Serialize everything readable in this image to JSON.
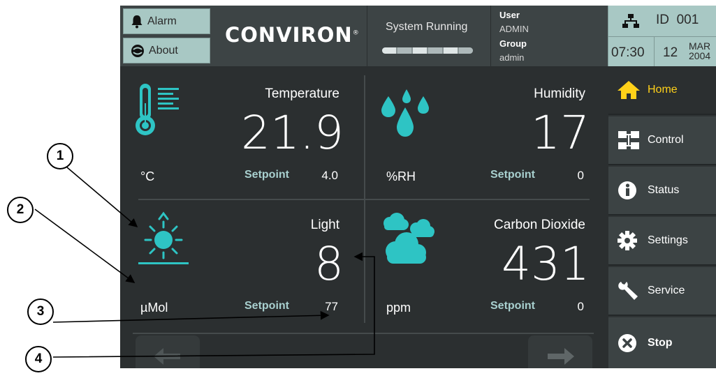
{
  "header": {
    "alarm_label": "Alarm",
    "about_label": "About",
    "logo_text": "CONVIRON",
    "logo_mark": "®",
    "system_status": "System Running",
    "user_label": "User",
    "user_value": "ADMIN",
    "group_label": "Group",
    "group_value": "admin",
    "id_label": "ID",
    "id_value": "001",
    "time": "07:30",
    "day": "12",
    "month": "MAR",
    "year": "2004"
  },
  "tiles": {
    "temperature": {
      "label": "Temperature",
      "value": "21.9",
      "unit": "°C",
      "setpoint_label": "Setpoint",
      "setpoint_value": "4.0",
      "icon": "thermometer-icon"
    },
    "humidity": {
      "label": "Humidity",
      "value": "17",
      "unit": "%RH",
      "setpoint_label": "Setpoint",
      "setpoint_value": "0",
      "icon": "water-drops-icon"
    },
    "light": {
      "label": "Light",
      "value": "8",
      "unit": "µMol",
      "setpoint_label": "Setpoint",
      "setpoint_value": "77",
      "icon": "sun-icon"
    },
    "co2": {
      "label": "Carbon Dioxide",
      "value": "431",
      "unit": "ppm",
      "setpoint_label": "Setpoint",
      "setpoint_value": "0",
      "icon": "clouds-icon"
    }
  },
  "nav": {
    "items": [
      {
        "label": "Home",
        "icon": "home-icon",
        "active": true
      },
      {
        "label": "Control",
        "icon": "control-icon"
      },
      {
        "label": "Status",
        "icon": "info-icon"
      },
      {
        "label": "Settings",
        "icon": "gear-icon"
      },
      {
        "label": "Service",
        "icon": "wrench-icon"
      },
      {
        "label": "Stop",
        "icon": "stop-icon"
      }
    ]
  },
  "bottom": {
    "prev_icon": "arrow-left-icon",
    "next_icon": "arrow-right-icon"
  },
  "callouts": [
    "1",
    "2",
    "3",
    "4"
  ],
  "colors": {
    "accent": "#2ec4c4",
    "active_nav": "#ffd119",
    "panel": "#2b2f30",
    "header_button": "#a8c8c4"
  }
}
